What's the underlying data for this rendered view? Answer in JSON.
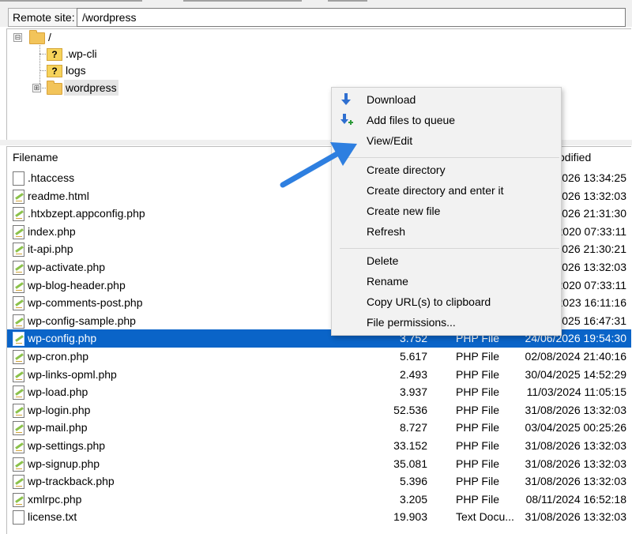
{
  "remote_site": {
    "label": "Remote site:",
    "path": "/wordpress"
  },
  "tree": {
    "root": {
      "label": "/",
      "expander": "⊟"
    },
    "children": [
      {
        "label": ".wp-cli",
        "icon": "unknown-folder-icon"
      },
      {
        "label": "logs",
        "icon": "unknown-folder-icon"
      },
      {
        "label": "wordpress",
        "icon": "folder-icon",
        "expander": "⊞"
      }
    ]
  },
  "file_list": {
    "headers": {
      "filename": "Filename",
      "modified": "odified"
    },
    "rows": [
      {
        "name": ".htaccess",
        "size": "",
        "type": "",
        "modified": "/2026 13:34:25",
        "icon": "file-icon",
        "selected": false
      },
      {
        "name": "readme.html",
        "size": "",
        "type": "",
        "modified": "/2026 13:32:03",
        "icon": "php-file-icon",
        "selected": false
      },
      {
        "name": ".htxbzept.appconfig.php",
        "size": "",
        "type": "",
        "modified": "/2026 21:31:30",
        "icon": "php-file-icon",
        "selected": false
      },
      {
        "name": "index.php",
        "size": "",
        "type": "",
        "modified": "/2020 07:33:11",
        "icon": "php-file-icon",
        "selected": false
      },
      {
        "name": "it-api.php",
        "size": "",
        "type": "",
        "modified": "/2026 21:30:21",
        "icon": "php-file-icon",
        "selected": false
      },
      {
        "name": "wp-activate.php",
        "size": "",
        "type": "",
        "modified": "/2026 13:32:03",
        "icon": "php-file-icon",
        "selected": false
      },
      {
        "name": "wp-blog-header.php",
        "size": "",
        "type": "",
        "modified": "/2020 07:33:11",
        "icon": "php-file-icon",
        "selected": false
      },
      {
        "name": "wp-comments-post.php",
        "size": "",
        "type": "",
        "modified": "/2023 16:11:16",
        "icon": "php-file-icon",
        "selected": false
      },
      {
        "name": "wp-config-sample.php",
        "size": "",
        "type": "",
        "modified": "/2025 16:47:31",
        "icon": "php-file-icon",
        "selected": false
      },
      {
        "name": "wp-config.php",
        "size": "3.752",
        "type": "PHP File",
        "modified": "24/06/2026 19:54:30",
        "icon": "php-file-icon",
        "selected": true
      },
      {
        "name": "wp-cron.php",
        "size": "5.617",
        "type": "PHP File",
        "modified": "02/08/2024 21:40:16",
        "icon": "php-file-icon",
        "selected": false
      },
      {
        "name": "wp-links-opml.php",
        "size": "2.493",
        "type": "PHP File",
        "modified": "30/04/2025 14:52:29",
        "icon": "php-file-icon",
        "selected": false
      },
      {
        "name": "wp-load.php",
        "size": "3.937",
        "type": "PHP File",
        "modified": "11/03/2024 11:05:15",
        "icon": "php-file-icon",
        "selected": false
      },
      {
        "name": "wp-login.php",
        "size": "52.536",
        "type": "PHP File",
        "modified": "31/08/2026 13:32:03",
        "icon": "php-file-icon",
        "selected": false
      },
      {
        "name": "wp-mail.php",
        "size": "8.727",
        "type": "PHP File",
        "modified": "03/04/2025 00:25:26",
        "icon": "php-file-icon",
        "selected": false
      },
      {
        "name": "wp-settings.php",
        "size": "33.152",
        "type": "PHP File",
        "modified": "31/08/2026 13:32:03",
        "icon": "php-file-icon",
        "selected": false
      },
      {
        "name": "wp-signup.php",
        "size": "35.081",
        "type": "PHP File",
        "modified": "31/08/2026 13:32:03",
        "icon": "php-file-icon",
        "selected": false
      },
      {
        "name": "wp-trackback.php",
        "size": "5.396",
        "type": "PHP File",
        "modified": "31/08/2026 13:32:03",
        "icon": "php-file-icon",
        "selected": false
      },
      {
        "name": "xmlrpc.php",
        "size": "3.205",
        "type": "PHP File",
        "modified": "08/11/2024 16:52:18",
        "icon": "php-file-icon",
        "selected": false
      },
      {
        "name": "license.txt",
        "size": "19.903",
        "type": "Text Docu...",
        "modified": "31/08/2026 13:32:03",
        "icon": "file-icon",
        "selected": false
      }
    ]
  },
  "context_menu": {
    "items": [
      {
        "label": "Download",
        "icon": "download-icon"
      },
      {
        "label": "Add files to queue",
        "icon": "add-to-queue-icon"
      },
      {
        "label": "View/Edit",
        "icon": ""
      },
      {
        "label": "Create directory",
        "icon": ""
      },
      {
        "label": "Create directory and enter it",
        "icon": ""
      },
      {
        "label": "Create new file",
        "icon": ""
      },
      {
        "label": "Refresh",
        "icon": ""
      },
      {
        "label": "Delete",
        "icon": ""
      },
      {
        "label": "Rename",
        "icon": ""
      },
      {
        "label": "Copy URL(s) to clipboard",
        "icon": ""
      },
      {
        "label": "File permissions...",
        "icon": ""
      }
    ]
  },
  "colors": {
    "selection": "#0a64c8",
    "annotation_arrow": "#2e7fe0",
    "menu_bg": "#f2f2f2"
  }
}
